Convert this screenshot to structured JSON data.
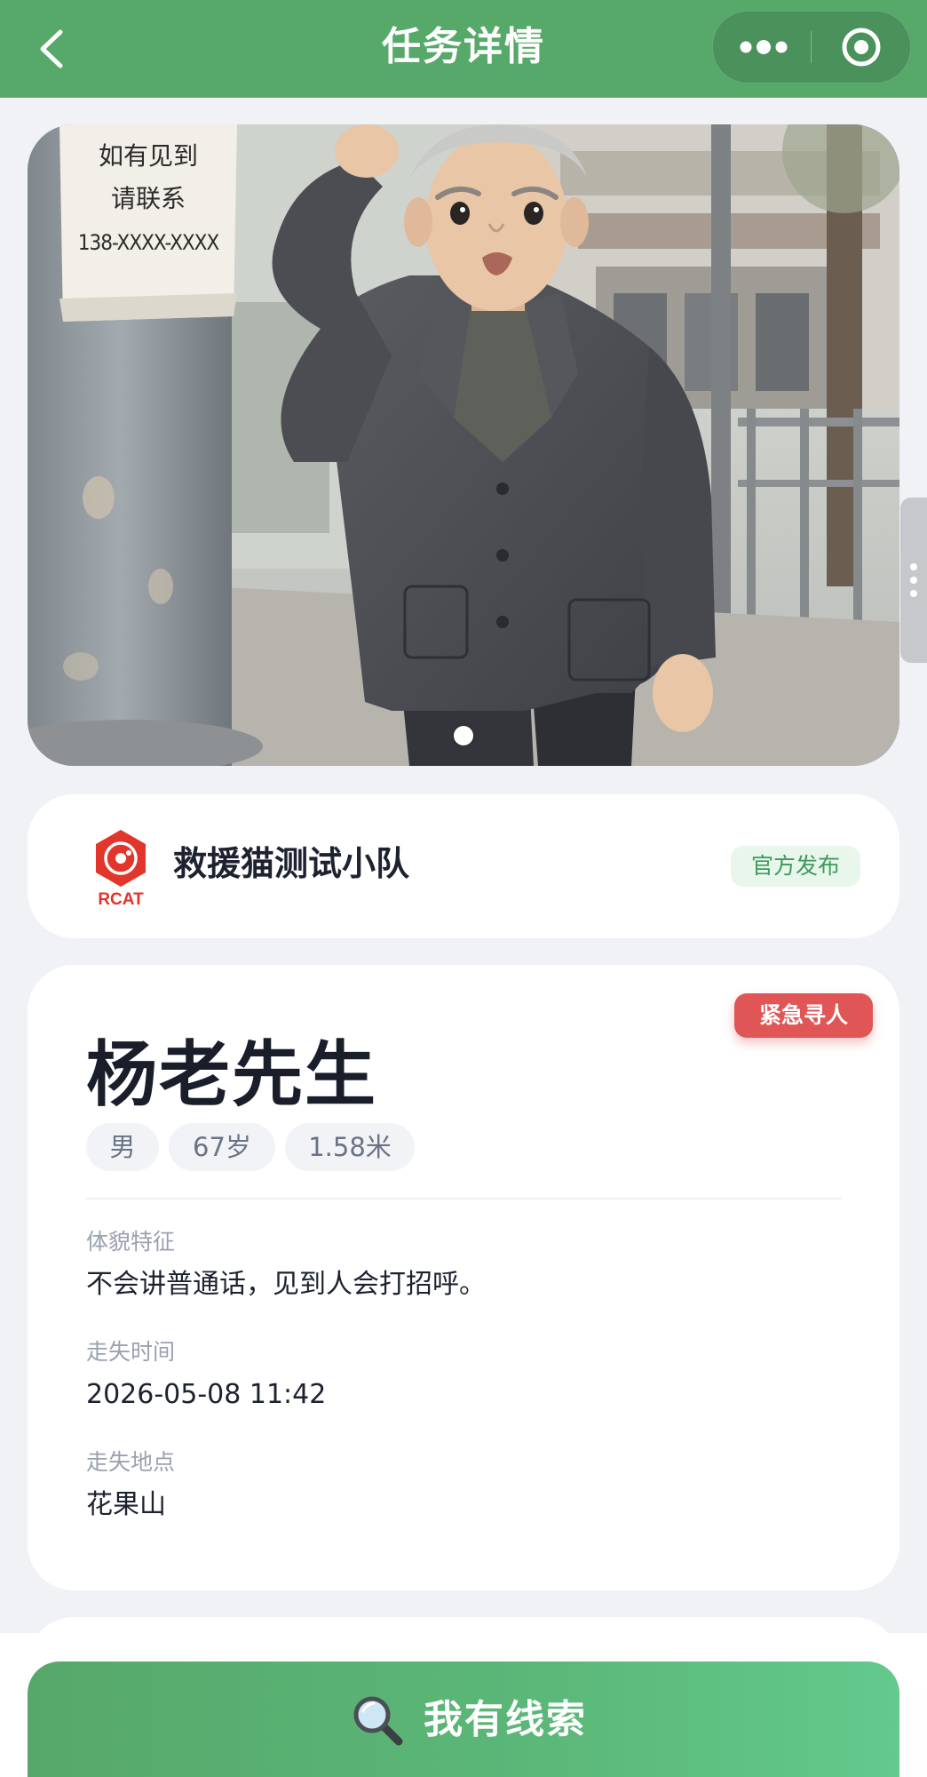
{
  "nav": {
    "title": "任务详情",
    "back_icon": "chevron-left-icon",
    "more_icon": "more-dots-icon",
    "close_icon": "target-circle-icon"
  },
  "hero": {
    "poster_lines": [
      "如有见到",
      "请联系",
      "138-XXXX-XXXX"
    ],
    "current_slide": 1,
    "slide_count": 1
  },
  "publisher": {
    "logo_text": "RCAT",
    "name": "救援猫测试小队",
    "badge": "官方发布"
  },
  "detail": {
    "urgent_badge": "紧急寻人",
    "name": "杨老先生",
    "tags": {
      "gender": "男",
      "age": "67岁",
      "height": "1.58米"
    },
    "fields": [
      {
        "label": "体貌特征",
        "value": "不会讲普通话，见到人会打招呼。"
      },
      {
        "label": "走失时间",
        "value": "2026-05-08 11:42"
      },
      {
        "label": "走失地点",
        "value": "花果山"
      }
    ]
  },
  "action": {
    "icon": "magnifier-icon",
    "label": "我有线索"
  },
  "colors": {
    "nav_green": "#57a96a",
    "urgent_red": "#e05555",
    "official_green": "#3e9a5c",
    "page_bg": "#f0f2f6"
  }
}
